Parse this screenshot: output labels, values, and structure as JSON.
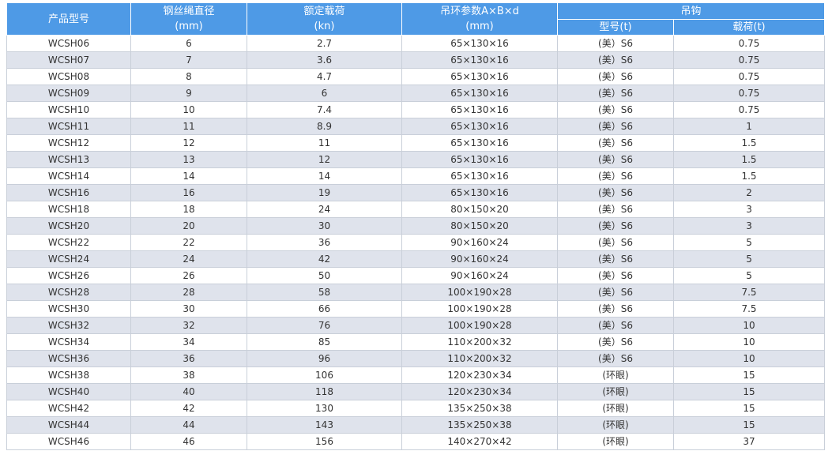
{
  "table": {
    "headers": {
      "model": "产品型号",
      "rope_diameter": "钢丝绳直径",
      "rope_diameter_unit": "(mm)",
      "rated_load": "额定载荷",
      "rated_load_unit": "(kn)",
      "ring_params": "吊环参数A×B×d",
      "ring_params_unit": "(mm)",
      "hook": "吊钩",
      "hook_model": "型号(t)",
      "hook_load": "载荷(t)"
    },
    "rows": [
      [
        "WCSH06",
        "6",
        "2.7",
        "65×130×16",
        "(美）S6",
        "0.75"
      ],
      [
        "WCSH07",
        "7",
        "3.6",
        "65×130×16",
        "(美）S6",
        "0.75"
      ],
      [
        "WCSH08",
        "8",
        "4.7",
        "65×130×16",
        "(美）S6",
        "0.75"
      ],
      [
        "WCSH09",
        "9",
        "6",
        "65×130×16",
        "(美）S6",
        "0.75"
      ],
      [
        "WCSH10",
        "10",
        "7.4",
        "65×130×16",
        "(美）S6",
        "0.75"
      ],
      [
        "WCSH11",
        "11",
        "8.9",
        "65×130×16",
        "(美）S6",
        "1"
      ],
      [
        "WCSH12",
        "12",
        "11",
        "65×130×16",
        "(美）S6",
        "1.5"
      ],
      [
        "WCSH13",
        "13",
        "12",
        "65×130×16",
        "(美）S6",
        "1.5"
      ],
      [
        "WCSH14",
        "14",
        "14",
        "65×130×16",
        "(美）S6",
        "1.5"
      ],
      [
        "WCSH16",
        "16",
        "19",
        "65×130×16",
        "(美）S6",
        "2"
      ],
      [
        "WCSH18",
        "18",
        "24",
        "80×150×20",
        "(美）S6",
        "3"
      ],
      [
        "WCSH20",
        "20",
        "30",
        "80×150×20",
        "(美）S6",
        "3"
      ],
      [
        "WCSH22",
        "22",
        "36",
        "90×160×24",
        "(美）S6",
        "5"
      ],
      [
        "WCSH24",
        "24",
        "42",
        "90×160×24",
        "(美）S6",
        "5"
      ],
      [
        "WCSH26",
        "26",
        "50",
        "90×160×24",
        "(美）S6",
        "5"
      ],
      [
        "WCSH28",
        "28",
        "58",
        "100×190×28",
        "(美）S6",
        "7.5"
      ],
      [
        "WCSH30",
        "30",
        "66",
        "100×190×28",
        "(美）S6",
        "7.5"
      ],
      [
        "WCSH32",
        "32",
        "76",
        "100×190×28",
        "(美）S6",
        "10"
      ],
      [
        "WCSH34",
        "34",
        "85",
        "110×200×32",
        "(美）S6",
        "10"
      ],
      [
        "WCSH36",
        "36",
        "96",
        "110×200×32",
        "(美）S6",
        "10"
      ],
      [
        "WCSH38",
        "38",
        "106",
        "120×230×34",
        "(环眼)",
        "15"
      ],
      [
        "WCSH40",
        "40",
        "118",
        "120×230×34",
        "(环眼)",
        "15"
      ],
      [
        "WCSH42",
        "42",
        "130",
        "135×250×38",
        "(环眼)",
        "15"
      ],
      [
        "WCSH44",
        "44",
        "143",
        "135×250×38",
        "(环眼)",
        "15"
      ],
      [
        "WCSH46",
        "46",
        "156",
        "140×270×42",
        "(环眼)",
        "37"
      ]
    ]
  }
}
